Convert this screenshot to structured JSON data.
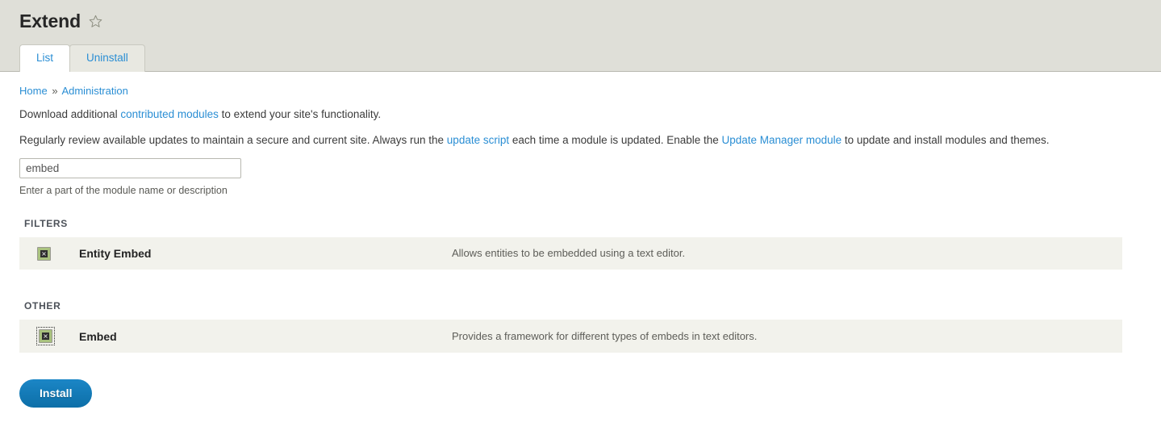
{
  "page": {
    "title": "Extend",
    "favorite_icon": "star-outline-icon"
  },
  "tabs": [
    {
      "label": "List",
      "active": true
    },
    {
      "label": "Uninstall",
      "active": false
    }
  ],
  "breadcrumb": {
    "items": [
      "Home",
      "Administration"
    ],
    "separator": "»"
  },
  "intro": {
    "line1_prefix": "Download additional ",
    "line1_link": "contributed modules",
    "line1_suffix": " to extend your site's functionality.",
    "line2_prefix": "Regularly review available updates to maintain a secure and current site. Always run the ",
    "line2_link1": "update script",
    "line2_middle": " each time a module is updated. Enable the ",
    "line2_link2": "Update Manager module",
    "line2_suffix": " to update and install modules and themes."
  },
  "search": {
    "value": "embed",
    "placeholder": "",
    "description": "Enter a part of the module name or description"
  },
  "groups": [
    {
      "title": "FILTERS",
      "modules": [
        {
          "checkbox_icon": "broken-image-icon",
          "focused": false,
          "name": "Entity Embed",
          "description": "Allows entities to be embedded using a text editor.",
          "glyph": "☒"
        }
      ]
    },
    {
      "title": "OTHER",
      "modules": [
        {
          "checkbox_icon": "broken-image-icon",
          "focused": true,
          "name": "Embed",
          "description": "Provides a framework for different types of embeds in text editors.",
          "glyph": "☒"
        }
      ]
    }
  ],
  "actions": {
    "install_label": "Install"
  },
  "colors": {
    "link": "#2a8ed4",
    "primary_button": "#1077b5",
    "header_band": "#dfdfd8",
    "row_background": "#f2f2ec",
    "checkbox_fill": "#a9c27e"
  }
}
